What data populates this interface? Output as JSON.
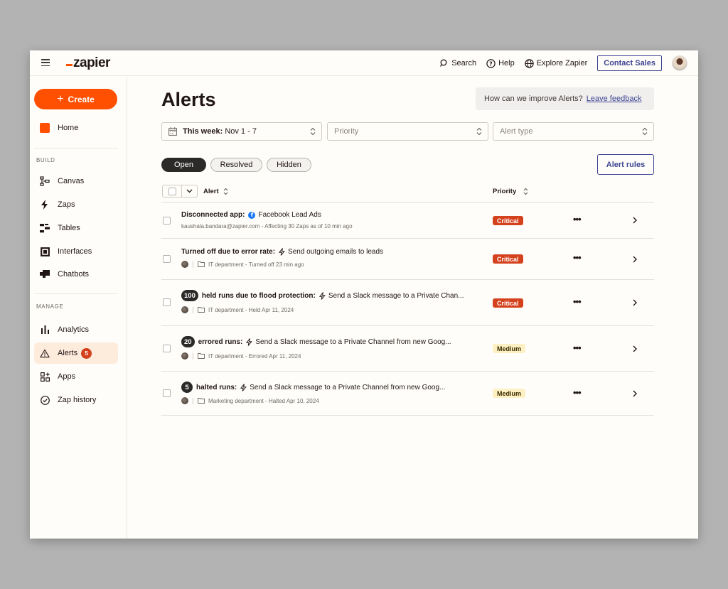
{
  "header": {
    "logo": "zapier",
    "search_label": "Search",
    "help_label": "Help",
    "explore_label": "Explore Zapier",
    "contact_label": "Contact Sales"
  },
  "sidebar": {
    "create_label": "Create",
    "home_label": "Home",
    "build_section": "BUILD",
    "build_items": [
      {
        "label": "Canvas",
        "icon": "canvas-icon"
      },
      {
        "label": "Zaps",
        "icon": "bolt-icon"
      },
      {
        "label": "Tables",
        "icon": "tables-icon"
      },
      {
        "label": "Interfaces",
        "icon": "interfaces-icon"
      },
      {
        "label": "Chatbots",
        "icon": "chatbot-icon"
      }
    ],
    "manage_section": "MANAGE",
    "manage_items": [
      {
        "label": "Analytics",
        "icon": "analytics-icon"
      },
      {
        "label": "Alerts",
        "icon": "warning-icon",
        "badge": "5",
        "active": true
      },
      {
        "label": "Apps",
        "icon": "apps-icon"
      },
      {
        "label": "Zap history",
        "icon": "check-circle-icon"
      }
    ]
  },
  "main": {
    "title": "Alerts",
    "feedback_text": "How can we improve Alerts?",
    "feedback_link": "Leave feedback",
    "filters": {
      "date_bold": "This week:",
      "date_range": "Nov 1 - 7",
      "priority_placeholder": "Priority",
      "alert_type_placeholder": "Alert type"
    },
    "tabs": [
      "Open",
      "Resolved",
      "Hidden"
    ],
    "alert_rules_label": "Alert rules",
    "columns": {
      "alert": "Alert",
      "priority": "Priority"
    },
    "rows": [
      {
        "count": "",
        "title": "Disconnected app:",
        "app_icon": "facebook-icon",
        "subject": "Facebook Lead Ads",
        "meta_plain": "kaushala.bandara@zapier.com - Affecting 30 Zaps as of 10 min ago",
        "folder": "",
        "meta": "",
        "priority": "Critical"
      },
      {
        "count": "",
        "title": "Turned off due to error rate:",
        "app_icon": "bolt-icon",
        "subject": "Send outgoing emails to leads",
        "meta_plain": "",
        "folder": "IT department",
        "meta": "Turned off 23 min ago",
        "priority": "Critical"
      },
      {
        "count": "100",
        "title": "held runs due to flood protection:",
        "app_icon": "bolt-icon",
        "subject": "Send a Slack message to a Private Chan...",
        "meta_plain": "",
        "folder": "IT department",
        "meta": "Held Apr 11, 2024",
        "priority": "Critical"
      },
      {
        "count": "20",
        "title": "errored runs:",
        "app_icon": "bolt-icon",
        "subject": "Send a Slack message to a Private Channel from new Goog...",
        "meta_plain": "",
        "folder": "IT department",
        "meta": "Errored Apr 11, 2024",
        "priority": "Medium"
      },
      {
        "count": "5",
        "title": "halted runs:",
        "app_icon": "bolt-icon",
        "subject": "Send a Slack message to a Private Channel from new Goog...",
        "meta_plain": "",
        "folder": "Marketing department",
        "meta": "Halted Apr 10, 2024",
        "priority": "Medium"
      }
    ]
  }
}
